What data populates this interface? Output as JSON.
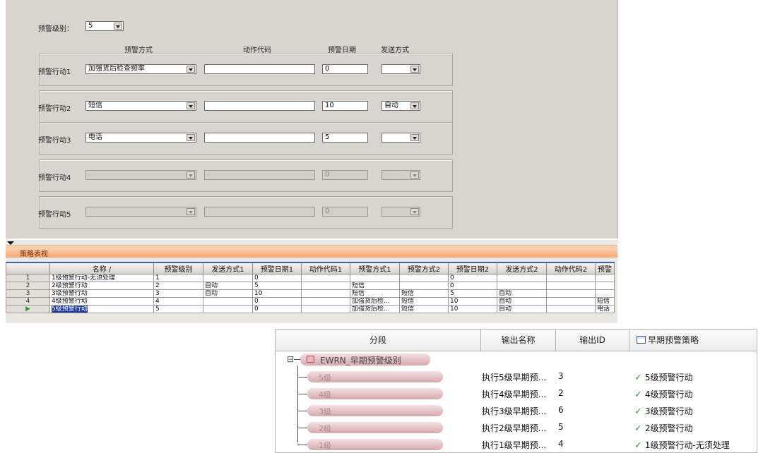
{
  "config": {
    "level_label": "预警级别：",
    "level_value": "5",
    "columns": {
      "method": "预警方式",
      "action_code": "动作代码",
      "date": "预警日期",
      "send": "发送方式"
    },
    "actions": [
      {
        "label": "预警行动1",
        "method": "加强货后检查频率",
        "code": "",
        "date": "0",
        "send": "",
        "enabled": true
      },
      {
        "label": "预警行动2",
        "method": "短信",
        "code": "",
        "date": "10",
        "send": "自动",
        "enabled": true
      },
      {
        "label": "预警行动3",
        "method": "电话",
        "code": "",
        "date": "5",
        "send": "",
        "enabled": true
      },
      {
        "label": "预警行动4",
        "method": "",
        "code": "",
        "date": "0",
        "send": "",
        "enabled": false
      },
      {
        "label": "预警行动5",
        "method": "",
        "code": "",
        "date": "0",
        "send": "",
        "enabled": false
      }
    ]
  },
  "strategy": {
    "title": "策略表视",
    "columns": [
      "",
      "名称 /",
      "预警级别",
      "发送方式1",
      "预警日期1",
      "动作代码1",
      "预警方式1",
      "预警方式2",
      "预警日期2",
      "发送方式2",
      "动作代码2",
      "预警"
    ],
    "rows": [
      {
        "num": "1",
        "name": "1级预警行动-无须处理",
        "level": "1",
        "send1": "",
        "date1": "0",
        "code1": "",
        "method1": "",
        "method2": "",
        "date2": "0",
        "send2": "",
        "code2": "",
        "extra": ""
      },
      {
        "num": "2",
        "name": "2级预警行动",
        "level": "2",
        "send1": "自动",
        "date1": "5",
        "code1": "",
        "method1": "短信",
        "method2": "",
        "date2": "0",
        "send2": "",
        "code2": "",
        "extra": ""
      },
      {
        "num": "3",
        "name": "3级预警行动",
        "level": "3",
        "send1": "自动",
        "date1": "10",
        "code1": "",
        "method1": "短信",
        "method2": "短信",
        "date2": "5",
        "send2": "自动",
        "code2": "",
        "extra": ""
      },
      {
        "num": "4",
        "name": "4级预警行动",
        "level": "4",
        "send1": "",
        "date1": "0",
        "code1": "",
        "method1": "加强货后检...",
        "method2": "短信",
        "date2": "10",
        "send2": "自动",
        "code2": "",
        "extra": "短信"
      },
      {
        "num": "▶",
        "name": "5级预警行动",
        "level": "5",
        "send1": "",
        "date1": "0",
        "code1": "",
        "method1": "加强货后检...",
        "method2": "短信",
        "date2": "10",
        "send2": "自动",
        "code2": "",
        "extra": "电话"
      }
    ]
  },
  "tree": {
    "headers": {
      "segment": "分段",
      "output_name": "输出名称",
      "output_id": "输出ID",
      "policy": "早期预警策略"
    },
    "root": "EWRN_早期预警级别",
    "expand_symbol": "⊟",
    "rows": [
      {
        "segment": "5级",
        "output_name": "执行5级早期预...",
        "output_id": "3",
        "policy": "5级预警行动"
      },
      {
        "segment": "4级",
        "output_name": "执行4级早期预...",
        "output_id": "2",
        "policy": "4级预警行动"
      },
      {
        "segment": "3级",
        "output_name": "执行3级早期预...",
        "output_id": "6",
        "policy": "3级预警行动"
      },
      {
        "segment": "2级",
        "output_name": "执行2级早期预...",
        "output_id": "5",
        "policy": "2级预警行动"
      },
      {
        "segment": "1级",
        "output_name": "执行1级早期预...",
        "output_id": "4",
        "policy": "1级预警行动-无须处理"
      }
    ]
  },
  "icons": {
    "check": "check-icon",
    "table": "table-icon",
    "node": "node-icon"
  }
}
